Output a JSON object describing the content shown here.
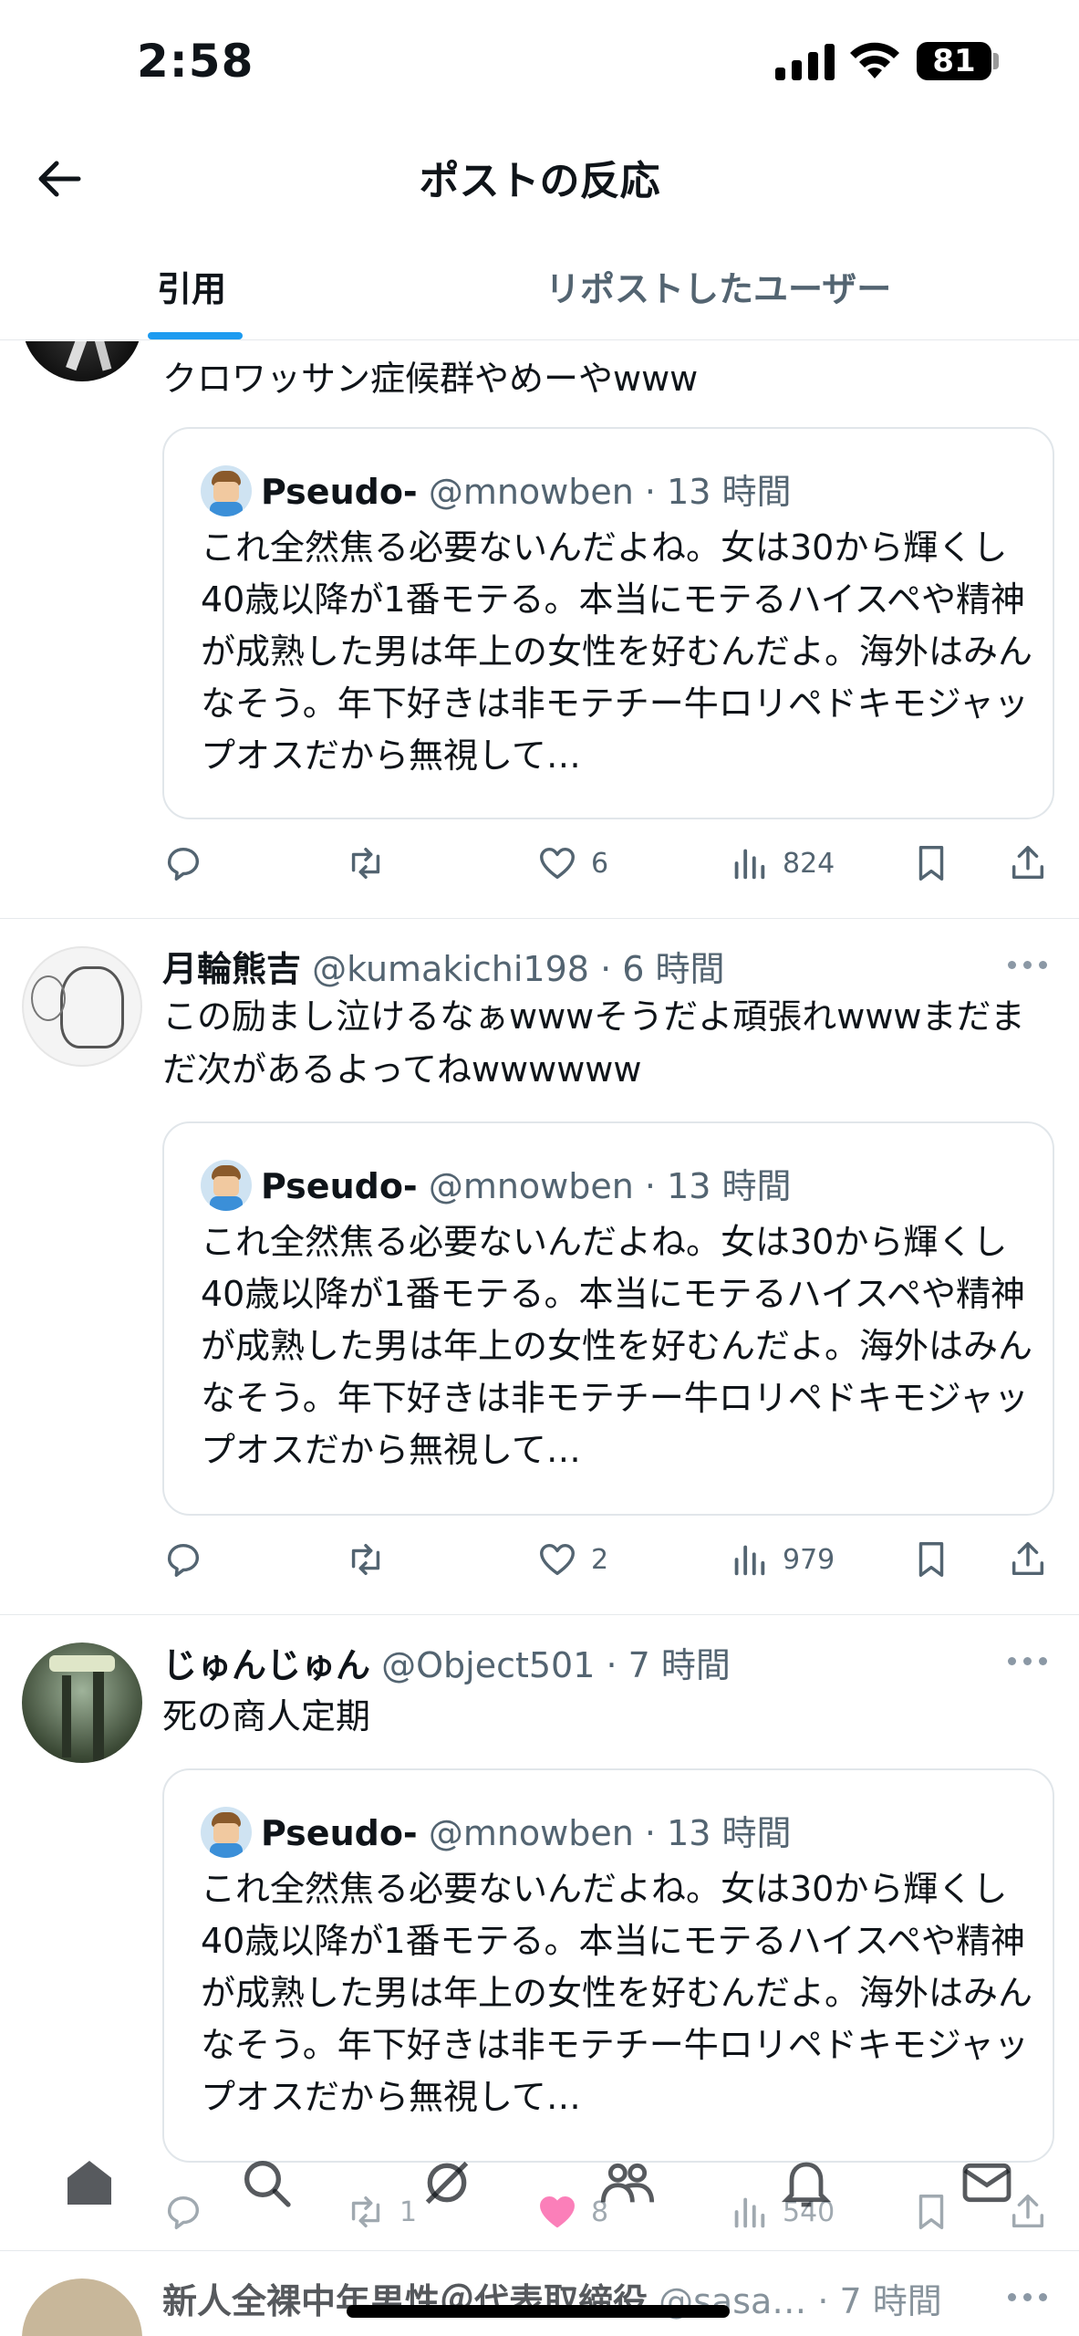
{
  "status_bar": {
    "time": "2:58",
    "battery": "81"
  },
  "header": {
    "title": "ポストの反応"
  },
  "tabs": [
    {
      "label": "引用",
      "active": true
    },
    {
      "label": "リポストしたユーザー",
      "active": false
    }
  ],
  "quoted_post": {
    "name": "Pseudo-",
    "handle": "@mnowben",
    "time": "· 13 時間",
    "text": "これ全然焦る必要ないんだよね。女は30から輝くし40歳以降が1番モテる。本当にモテるハイスペや精神が成熟した男は年上の女性を好むんだよ。海外はみんなそう。年下好きは非モテチー牛ロリペドキモジャップオスだから無視して…"
  },
  "posts": [
    {
      "text": "クロワッサン症候群やめーやwww",
      "likes": "6",
      "views": "824"
    },
    {
      "name": "月輪熊吉",
      "handle": "@kumakichi198",
      "time": "· 6 時間",
      "text": "この励まし泣けるなぁwwwそうだよ頑張れwwwまだまだ次があるよってねwwwwww",
      "likes": "2",
      "views": "979"
    },
    {
      "name": "じゅんじゅん",
      "handle": "@Object501",
      "time": "· 7 時間",
      "text": "死の商人定期",
      "reposts": "1",
      "likes": "8",
      "views": "540"
    },
    {
      "name": "新人全裸中年男性＠代表取締役",
      "handle": "@sasa…",
      "time": "· 7 時間"
    }
  ],
  "colors": {
    "accent": "#1d9bf0",
    "text": "#0f1419",
    "muted": "#536471",
    "like_active": "#f91880"
  }
}
